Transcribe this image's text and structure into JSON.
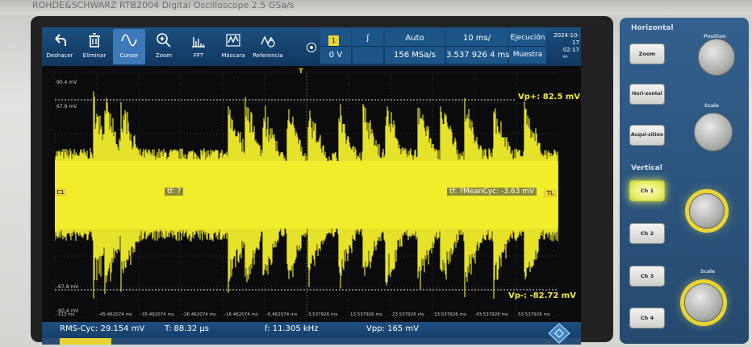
{
  "window": {
    "header_text": "ROHDE&SCHWARZ   RTB2004   Digital Oscilloscope   2.5 GSa/s"
  },
  "toolbar": {
    "items": [
      {
        "label": "Deshacer",
        "icon": "undo-icon"
      },
      {
        "label": "Eliminar",
        "icon": "trash-icon"
      },
      {
        "label": "Cursor",
        "icon": "cursor-wave-icon",
        "active": true
      },
      {
        "label": "Zoom",
        "icon": "zoom-icon"
      },
      {
        "label": "FFT",
        "icon": "fft-icon"
      },
      {
        "label": "Máscara",
        "icon": "mask-icon"
      },
      {
        "label": "Referencia",
        "icon": "reference-icon"
      }
    ]
  },
  "header": {
    "trigger_source": "1",
    "trigger_slope": "ʃ",
    "trigger_level": "0 V",
    "trigger_mode": "Auto",
    "sample_rate": "156 MSa/s",
    "time_scale": "10 ms/",
    "time_position": "3.537 926 4 ms",
    "run_state": "Ejecución",
    "acq_mode": "Muestra",
    "date": "2024-10-17",
    "time": "02:17"
  },
  "plot": {
    "y_labels": [
      "90.4 mV",
      "67.8 mV",
      "-67.8 mV",
      "-90.4 mV"
    ],
    "x_labels": [
      "-113 ms",
      "-45.462074 ms",
      "-35.462074 ms",
      "-26.462074 ms",
      "-16.462074 ms",
      "-6.462074 ms",
      "3.537926 ms",
      "13.537926 ms",
      "23.537926 ms",
      "33.537926 ms",
      "43.537926 ms",
      "53.537926 ms"
    ],
    "channel_marker": "C1",
    "trigger_marker": "T",
    "trigger_level_marker": "TL",
    "cursor_vp_plus": "Vp+: 82.5 mV",
    "cursor_vp_minus": "Vp-: -82.72 mV",
    "label_tf_left": "tf: ?",
    "label_tf_right": "tf: ?MeanCyc: -3.63 mV",
    "colors": {
      "trace": "#f2ee2c",
      "grid": "#3b3b3b",
      "cursor_label_bg": "#8a8a37"
    }
  },
  "readout": {
    "rms": "RMS-Cyc: 29.154 mV",
    "period": "T: 88.32 µs",
    "frequency": "f: 11.305 kHz",
    "vpp": "Vpp: 165 mV"
  },
  "panel": {
    "horizontal_title": "Horizontal",
    "zoom_button": "Zoom",
    "horizontal_button": "Hori-zontal",
    "acquisition_button": "Acqui-sition",
    "position_label": "Position",
    "scale_label_h": "Scale",
    "vertical_title": "Vertical",
    "channels": [
      "Ch 1",
      "Ch 2",
      "Ch 3",
      "Ch 4"
    ],
    "scale_label_v": "Scale"
  }
}
